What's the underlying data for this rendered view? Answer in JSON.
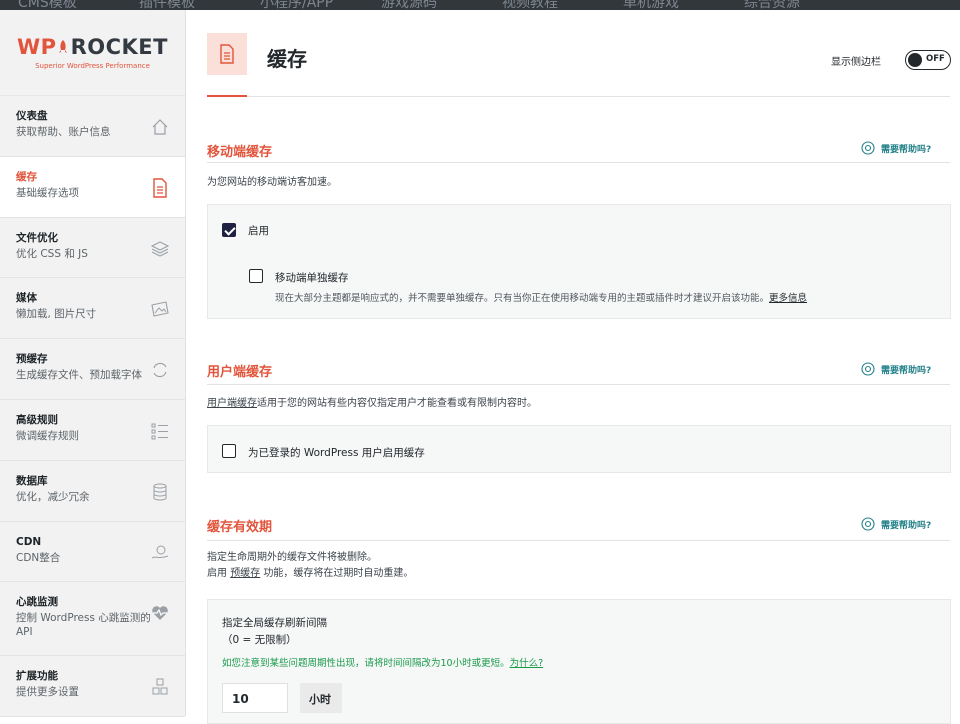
{
  "top_tabs": [
    "CMS模板",
    "插件模板",
    "小程序/APP",
    "游戏源码",
    "视频教程",
    "单机游戏",
    "综合资源"
  ],
  "logo": {
    "wp": "WP",
    "rocket": "ROCKET",
    "tagline": "Superior WordPress Performance"
  },
  "sidebar": {
    "items": [
      {
        "title": "仪表盘",
        "desc": "获取帮助、账户信息",
        "icon": "home-icon"
      },
      {
        "title": "缓存",
        "desc": "基础缓存选项",
        "icon": "document-icon",
        "active": true
      },
      {
        "title": "文件优化",
        "desc": "优化 CSS 和 JS",
        "icon": "layers-icon"
      },
      {
        "title": "媒体",
        "desc": "懒加载, 图片尺寸",
        "icon": "image-icon"
      },
      {
        "title": "预缓存",
        "desc": "生成缓存文件、预加载字体",
        "icon": "refresh-icon"
      },
      {
        "title": "高级规则",
        "desc": "微调缓存规则",
        "icon": "list-icon"
      },
      {
        "title": "数据库",
        "desc": "优化，减少冗余",
        "icon": "database-icon"
      },
      {
        "title": "CDN",
        "desc": "CDN整合",
        "icon": "cdn-icon"
      },
      {
        "title": "心跳监测",
        "desc": "控制 WordPress 心跳监测的 API",
        "icon": "heart-icon"
      },
      {
        "title": "扩展功能",
        "desc": "提供更多设置",
        "icon": "addons-icon"
      }
    ]
  },
  "page": {
    "title": "缓存",
    "sidebar_toggle_label": "显示侧边栏",
    "sidebar_toggle_state": "OFF"
  },
  "help_label": "需要帮助吗?",
  "mobile": {
    "title": "移动端缓存",
    "desc": "为您网站的移动端访客加速。",
    "enable_label": "启用",
    "enable_checked": true,
    "separate_label": "移动端单独缓存",
    "separate_checked": false,
    "separate_desc": "现在大部分主题都是响应式的，并不需要单独缓存。只有当你正在使用移动端专用的主题或插件时才建议开启该功能。",
    "more_info": "更多信息"
  },
  "user": {
    "title": "用户端缓存",
    "desc_link": "用户端缓存",
    "desc_rest": "适用于您的网站有些内容仅指定用户才能查看或有限制内容时。",
    "option_label": "为已登录的 WordPress 用户启用缓存",
    "option_checked": false
  },
  "lifespan": {
    "title": "缓存有效期",
    "desc_line1": "指定生命周期外的缓存文件将被删除。",
    "desc_line2_a": "启用 ",
    "desc_line2_link": "预缓存",
    "desc_line2_b": " 功能，缓存将在过期时自动重建。",
    "field_label": "指定全局缓存刷新间隔",
    "field_hint": "（0 = 无限制）",
    "tip": "如您注意到某些问题周期性出现，请将时间间隔改为10小时或更短。",
    "tip_link": "为什么?",
    "value": "10",
    "unit": "小时"
  },
  "colors": {
    "accent": "#e2553c",
    "help": "#23818a",
    "tip": "#1a9a4b"
  }
}
